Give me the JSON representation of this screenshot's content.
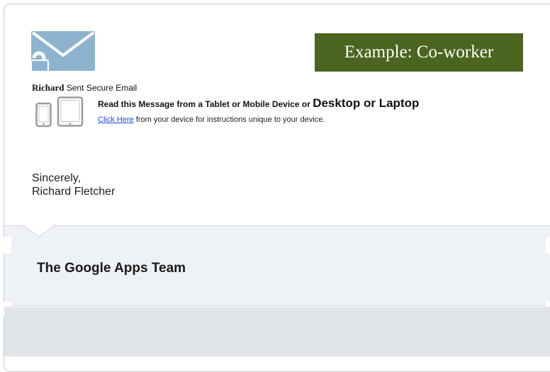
{
  "badge": {
    "text": "Example: Co-worker",
    "color": "#4b6420"
  },
  "email": {
    "sender_name": "Richard",
    "sender_suffix": " Sent Secure Email",
    "read_prefix": "Read this Message from a Tablet or Mobile Device or ",
    "read_emphasis": "Desktop or Laptop",
    "link_text": "Click Here",
    "link_suffix": " from your device for instructions unique to your device.",
    "closing": "Sincerely,",
    "signature": "Richard Fletcher",
    "link_color": "#1a4fd6"
  },
  "footer": {
    "team": "The Google Apps Team"
  },
  "icons": {
    "mail": "mail-lock-icon",
    "devices": "tablet-phone-icon"
  },
  "colors": {
    "mail_icon": "#8db3cf",
    "footer_band": "#eef2f6",
    "bottom_strip": "#e1e5ea"
  }
}
